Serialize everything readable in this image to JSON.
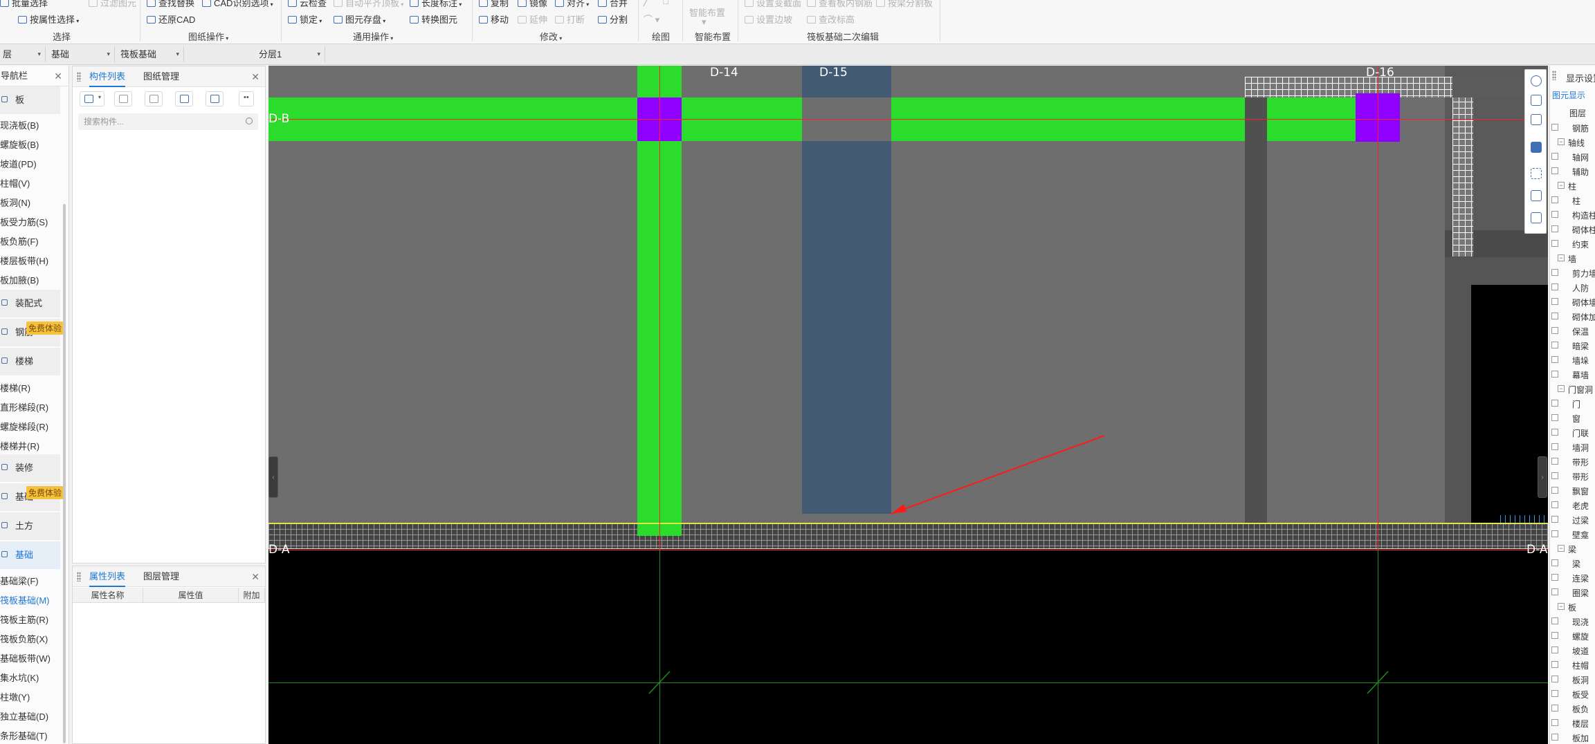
{
  "ribbon": {
    "items": [
      {
        "id": "batch-select",
        "label": "批量选择",
        "disabled": false
      },
      {
        "id": "filter-element",
        "label": "过滤图元",
        "disabled": true
      },
      {
        "id": "select-by-attr",
        "label": "按属性选择",
        "disabled": false
      },
      {
        "id": "find-replace",
        "label": "查找替换",
        "disabled": false
      },
      {
        "id": "cad-recognize-options",
        "label": "CAD识别选项",
        "disabled": false
      },
      {
        "id": "restore-cad",
        "label": "还原CAD",
        "disabled": false
      },
      {
        "id": "cloud-check",
        "label": "云检查",
        "disabled": false
      },
      {
        "id": "auto-level-slab",
        "label": "自动平齐顶板",
        "disabled": true
      },
      {
        "id": "length-annotation",
        "label": "长度标注",
        "disabled": false
      },
      {
        "id": "lock",
        "label": "锁定",
        "disabled": false
      },
      {
        "id": "element-save",
        "label": "图元存盘",
        "disabled": false
      },
      {
        "id": "convert-element",
        "label": "转换图元",
        "disabled": false
      },
      {
        "id": "copy",
        "label": "复制",
        "disabled": false
      },
      {
        "id": "mirror",
        "label": "镜像",
        "disabled": false
      },
      {
        "id": "align",
        "label": "对齐",
        "disabled": false
      },
      {
        "id": "merge",
        "label": "合并",
        "disabled": false
      },
      {
        "id": "move",
        "label": "移动",
        "disabled": false
      },
      {
        "id": "extend",
        "label": "延伸",
        "disabled": true
      },
      {
        "id": "break",
        "label": "打断",
        "disabled": true
      },
      {
        "id": "split",
        "label": "分割",
        "disabled": false
      },
      {
        "id": "smart-layout",
        "label": "智能布置",
        "disabled": true
      },
      {
        "id": "set-edge-section",
        "label": "设置变截面",
        "disabled": true
      },
      {
        "id": "view-bottom-rebar",
        "label": "查看板内钢筋",
        "disabled": true
      },
      {
        "id": "sump-section",
        "label": "按梁分割板",
        "disabled": true
      },
      {
        "id": "set-side-slope",
        "label": "设置边坡",
        "disabled": true
      },
      {
        "id": "view-elevation",
        "label": "查改标高",
        "disabled": true
      }
    ],
    "groups": [
      {
        "id": "select",
        "label": "选择"
      },
      {
        "id": "drawing-ops",
        "label": "图纸操作"
      },
      {
        "id": "general-ops",
        "label": "通用操作"
      },
      {
        "id": "modify",
        "label": "修改"
      },
      {
        "id": "draw",
        "label": "绘图"
      },
      {
        "id": "smart",
        "label": "智能布置"
      },
      {
        "id": "raft-edit",
        "label": "筏板基础二次编辑"
      }
    ]
  },
  "layerbar": {
    "floor": "层",
    "category": "基础",
    "component": "筏板基础",
    "sublayer": "分层1"
  },
  "nav": {
    "title": "导航栏",
    "items_top": [
      "现浇板(B)",
      "螺旋板(B)",
      "柱帽(V)",
      "板洞(N)",
      "板受力筋(S)",
      "板负筋(F)",
      "楼层板带(H)",
      "板加腋(B)"
    ],
    "items_pd": "坡道(PD)",
    "cat_prefab": "装配式",
    "cat_rebar": "钢筋",
    "badge1": "免费体验",
    "cat_stairs": "楼梯",
    "items_stairs": [
      "楼梯(R)",
      "直形梯段(R)",
      "螺旋梯段(R)",
      "楼梯井(R)"
    ],
    "cat_decor": "装修",
    "cat_found_label": "基础",
    "badge2": "免费体验",
    "cat_earth": "土方",
    "cat_base": "基础",
    "items_base": [
      "基础梁(F)",
      "筏板基础(M)",
      "筏板主筋(R)",
      "筏板负筋(X)",
      "基础板带(W)",
      "集水坑(K)",
      "柱墩(Y)",
      "独立基础(D)",
      "条形基础(T)"
    ],
    "active_item": "筏板基础(M)"
  },
  "component_panel": {
    "tab_list": "构件列表",
    "tab_drawing": "图纸管理",
    "search_placeholder": "搜索构件..."
  },
  "property_panel": {
    "tab_props": "属性列表",
    "tab_layers": "图层管理",
    "col_name": "属性名称",
    "col_value": "属性值",
    "col_extra": "附加"
  },
  "canvas": {
    "axis_labels": [
      "D-14",
      "D-15",
      "D-16",
      "D-B",
      "D-A",
      "D-A"
    ],
    "colors": {
      "beam": "#2cdc2c",
      "column": "#9000ff",
      "slab": "#6e6e6e",
      "hole": "#435a73",
      "axis_line": "#ff2020",
      "edge_line": "#e4e44a",
      "grid_green": "#1e8c1e"
    }
  },
  "display_panel": {
    "title": "显示设置",
    "tab": "图元显示",
    "header": "图层",
    "rows": [
      {
        "level": 2,
        "text": "钢筋"
      },
      {
        "level": 1,
        "text": "轴线"
      },
      {
        "level": 2,
        "text": "轴网"
      },
      {
        "level": 2,
        "text": "辅助"
      },
      {
        "level": 1,
        "text": "柱"
      },
      {
        "level": 2,
        "text": "柱"
      },
      {
        "level": 2,
        "text": "构造柱"
      },
      {
        "level": 2,
        "text": "砌体柱"
      },
      {
        "level": 2,
        "text": "约束"
      },
      {
        "level": 1,
        "text": "墙"
      },
      {
        "level": 2,
        "text": "剪力墙"
      },
      {
        "level": 2,
        "text": "人防"
      },
      {
        "level": 2,
        "text": "砌体墙"
      },
      {
        "level": 2,
        "text": "砌体加"
      },
      {
        "level": 2,
        "text": "保温"
      },
      {
        "level": 2,
        "text": "暗梁"
      },
      {
        "level": 2,
        "text": "墙垛"
      },
      {
        "level": 2,
        "text": "幕墙"
      },
      {
        "level": 1,
        "text": "门窗洞"
      },
      {
        "level": 2,
        "text": "门"
      },
      {
        "level": 2,
        "text": "窗"
      },
      {
        "level": 2,
        "text": "门联"
      },
      {
        "level": 2,
        "text": "墙洞"
      },
      {
        "level": 2,
        "text": "带形"
      },
      {
        "level": 2,
        "text": "带形"
      },
      {
        "level": 2,
        "text": "飘窗"
      },
      {
        "level": 2,
        "text": "老虎"
      },
      {
        "level": 2,
        "text": "过梁"
      },
      {
        "level": 2,
        "text": "壁龛"
      },
      {
        "level": 1,
        "text": "梁"
      },
      {
        "level": 2,
        "text": "梁"
      },
      {
        "level": 2,
        "text": "连梁"
      },
      {
        "level": 2,
        "text": "圈梁"
      },
      {
        "level": 1,
        "text": "板"
      },
      {
        "level": 2,
        "text": "现浇"
      },
      {
        "level": 2,
        "text": "螺旋"
      },
      {
        "level": 2,
        "text": "坡道"
      },
      {
        "level": 2,
        "text": "柱帽"
      },
      {
        "level": 2,
        "text": "板洞"
      },
      {
        "level": 2,
        "text": "板受"
      },
      {
        "level": 2,
        "text": "板负"
      },
      {
        "level": 2,
        "text": "楼层"
      },
      {
        "level": 2,
        "text": "板加"
      }
    ]
  }
}
